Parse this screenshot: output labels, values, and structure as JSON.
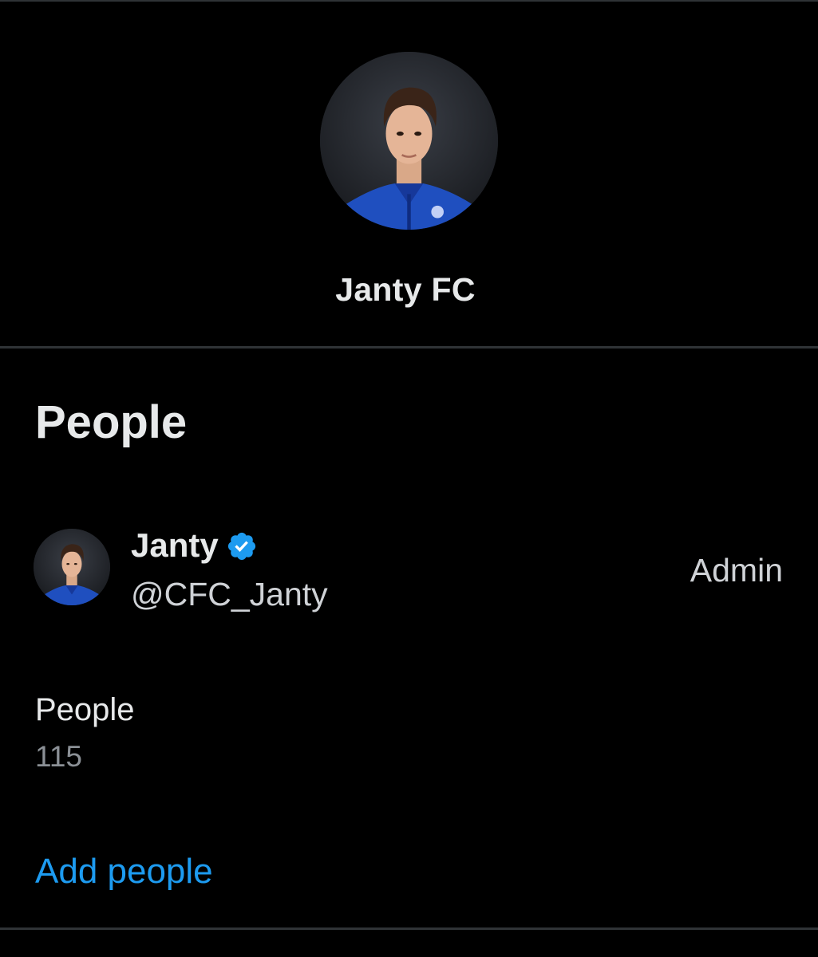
{
  "group": {
    "name": "Janty FC"
  },
  "section": {
    "title": "People"
  },
  "member": {
    "name": "Janty",
    "handle": "@CFC_Janty",
    "role": "Admin",
    "verified": true
  },
  "people_count": {
    "label": "People",
    "value": "115"
  },
  "actions": {
    "add_people_label": "Add people"
  },
  "colors": {
    "background": "#000000",
    "divider": "#2f3336",
    "primary_text": "#e7e9ea",
    "secondary_text": "#8b9096",
    "accent": "#1d9bf0",
    "verified_badge": "#1d9bf0"
  },
  "icons": {
    "verified": "verified-badge-icon"
  }
}
